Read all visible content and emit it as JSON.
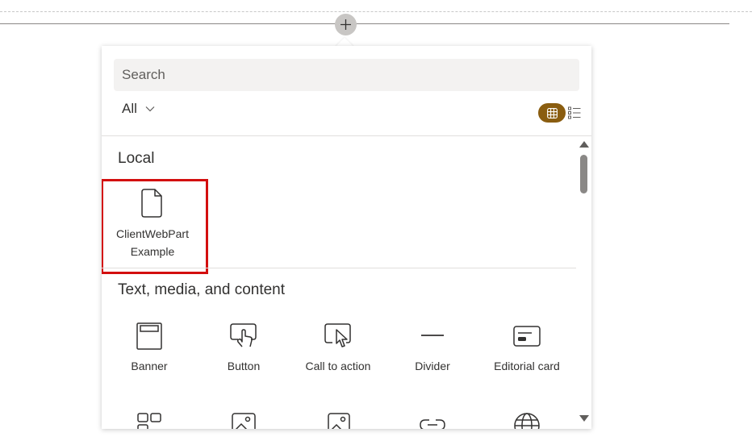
{
  "canvas": {
    "add_section_tooltip": ""
  },
  "picker": {
    "search": {
      "placeholder": "Search"
    },
    "filter": {
      "selected": "All",
      "icon": "chevron-down-icon"
    },
    "view_toggle": {
      "active": "grid",
      "accent_color": "#8a5d10"
    },
    "sections": [
      {
        "title": "Local",
        "items": [
          {
            "label_line1": "ClientWebPart",
            "label_line2": "Example",
            "icon": "document-icon",
            "highlighted": true
          }
        ]
      },
      {
        "title": "Text, media, and content",
        "items": [
          {
            "label": "Banner",
            "icon": "banner-icon"
          },
          {
            "label": "Button",
            "icon": "button-icon"
          },
          {
            "label": "Call to action",
            "icon": "call-to-action-icon"
          },
          {
            "label": "Divider",
            "icon": "divider-icon"
          },
          {
            "label": "Editorial card",
            "icon": "editorial-card-icon"
          }
        ]
      }
    ],
    "highlight_color": "#d30f0f"
  }
}
